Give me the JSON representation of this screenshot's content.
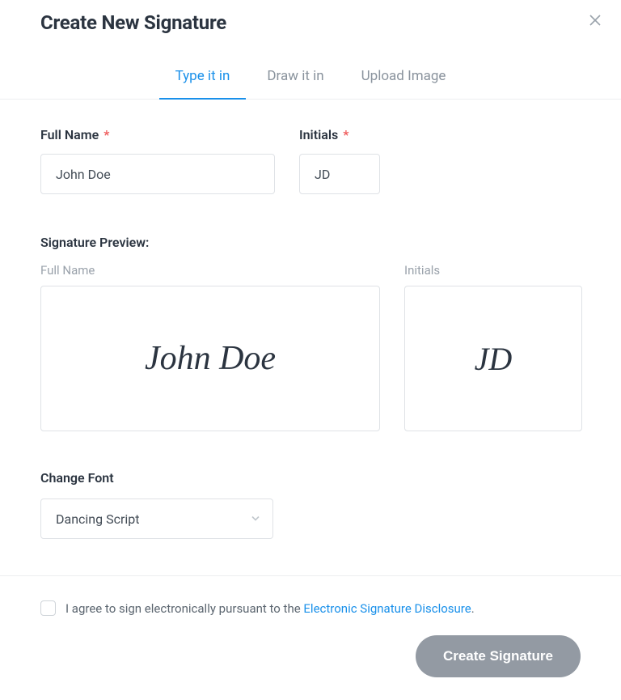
{
  "header": {
    "title": "Create New Signature"
  },
  "tabs": {
    "type_it_in": "Type it in",
    "draw_it_in": "Draw it in",
    "upload_image": "Upload Image"
  },
  "fields": {
    "fullname_label": "Full Name",
    "initials_label": "Initials",
    "required_mark": "*",
    "fullname_value": "John Doe",
    "initials_value": "JD"
  },
  "preview": {
    "section_label": "Signature Preview:",
    "fullname_sublabel": "Full Name",
    "initials_sublabel": "Initials",
    "fullname_sig": "John Doe",
    "initials_sig": "JD"
  },
  "font": {
    "label": "Change Font",
    "selected": "Dancing Script"
  },
  "footer": {
    "agree_prefix": "I agree to sign electronically pursuant to the ",
    "agree_link": "Electronic Signature Disclosure",
    "agree_suffix": ".",
    "submit_label": "Create Signature"
  }
}
